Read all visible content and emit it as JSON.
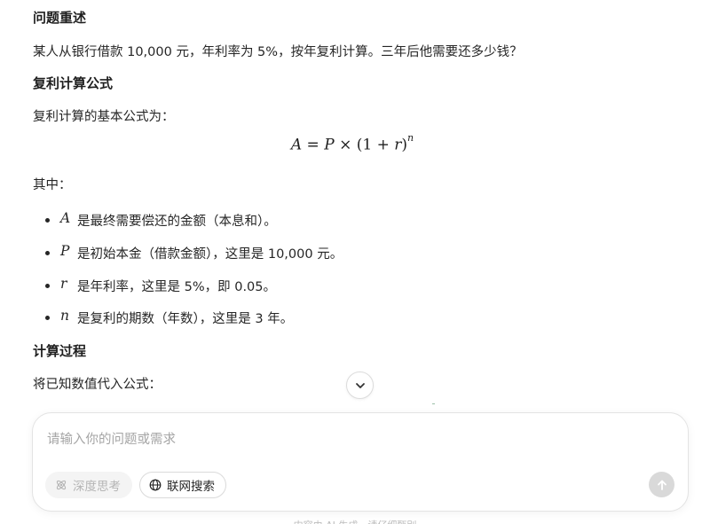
{
  "sections": {
    "problem": {
      "heading": "问题重述",
      "text": "某人从银行借款 10,000 元，年利率为 5%，按年复利计算。三年后他需要还多少钱？"
    },
    "formula": {
      "heading": "复利计算公式",
      "intro": "复利计算的基本公式为：",
      "lhs": "A",
      "eq": " = ",
      "p": "P",
      "times": " × (1 + ",
      "r": "r",
      "close": ")",
      "exp": "n",
      "where": "其中：",
      "items": [
        {
          "var": "A",
          "text": "是最终需要偿还的金额（本息和）。"
        },
        {
          "var": "P",
          "text": "是初始本金（借款金额），这里是 10,000 元。"
        },
        {
          "var": "r",
          "text": "是年利率，这里是 5%，即 0.05。"
        },
        {
          "var": "n",
          "text": "是复利的期数（年数），这里是 3 年。"
        }
      ]
    },
    "process": {
      "heading": "计算过程",
      "text": "将已知数值代入公式："
    }
  },
  "composer": {
    "placeholder": "请输入你的问题或需求",
    "deep_think_label": "深度思考",
    "web_search_label": "联网搜索",
    "icons": {
      "deep_think": "atom-icon",
      "web_search": "globe-icon",
      "send": "arrow-up-icon",
      "scroll": "chevron-down-icon"
    }
  },
  "footer": {
    "hint": "内容由 AI 生成，请仔细甄别"
  },
  "colors": {
    "text": "#262626",
    "muted": "#a5a5a5",
    "send_disabled": "#d9d9d9"
  }
}
